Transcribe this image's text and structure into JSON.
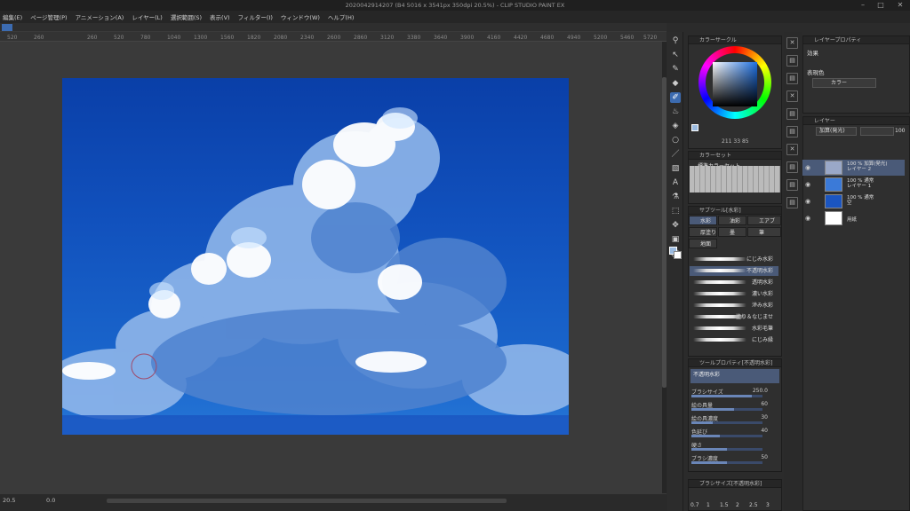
{
  "window": {
    "title": "2020042914207 (B4 5016 x 3541px 350dpi 20.5%) - CLIP STUDIO PAINT EX",
    "min": "–",
    "max": "□",
    "close": "✕"
  },
  "menu": [
    "編集(E)",
    "ページ管理(P)",
    "アニメーション(A)",
    "レイヤー(L)",
    "選択範囲(S)",
    "表示(V)",
    "フィルター(I)",
    "ウィンドウ(W)",
    "ヘルプ(H)"
  ],
  "ruler_ticks": [
    "520",
    "260",
    "260",
    "520",
    "780",
    "1040",
    "1300",
    "1560",
    "1820",
    "2080",
    "2340",
    "2600",
    "2860",
    "3120",
    "3380",
    "3640",
    "3900",
    "4160",
    "4420",
    "4680",
    "4940",
    "5200",
    "5460",
    "5720"
  ],
  "status": {
    "zoom": "20.5",
    "angle": "0.0"
  },
  "color_wheel": {
    "title": "カラーサークル",
    "h": "211",
    "s": "33",
    "v": "85"
  },
  "color_set": {
    "title": "カラーセット",
    "set_name": "標準カラーセット"
  },
  "sub_tool": {
    "title": "サブツール[水彩]",
    "tabs": [
      "水彩",
      "油彩",
      "エアブ",
      "厚塗り",
      "墨",
      "筆",
      "地面"
    ],
    "brushes": [
      "にじみ水彩",
      "不透明水彩",
      "透明水彩",
      "濃い水彩",
      "滲み水彩",
      "塗り＆なじませ",
      "水彩毛筆",
      "にじみ縁"
    ],
    "selected": 1
  },
  "tool_property": {
    "title": "ツールプロパティ[不透明水彩]",
    "tool_name": "不透明水彩",
    "props": [
      {
        "label": "ブラシサイズ",
        "value": "250.0",
        "fill": 0.85
      },
      {
        "label": "絵の具量",
        "value": "60",
        "fill": 0.6
      },
      {
        "label": "絵の具濃度",
        "value": "30",
        "fill": 0.3
      },
      {
        "label": "色延び",
        "value": "40",
        "fill": 0.4
      },
      {
        "label": "硬さ",
        "value": "",
        "fill": 0.5
      },
      {
        "label": "ブラシ濃度",
        "value": "50",
        "fill": 0.5
      }
    ]
  },
  "brush_size": {
    "title": "ブラシサイズ[不透明水彩]",
    "sizes": [
      "0.7",
      "1",
      "1.5",
      "2",
      "2.5",
      "3"
    ]
  },
  "layer_property": {
    "title": "レイヤープロパティ",
    "effect": "効果",
    "expression_label": "表現色",
    "expression_value": "カラー"
  },
  "layer_panel": {
    "title": "レイヤー",
    "blend": "加算(発光)",
    "opacity": "100",
    "layers": [
      {
        "line1": "100 % 加算(発光)",
        "line2": "レイヤー 2",
        "color": "#9aa8c8"
      },
      {
        "line1": "100 % 通常",
        "line2": "レイヤー 1",
        "color": "#3b7ad8"
      },
      {
        "line1": "100 % 通常",
        "line2": "空",
        "color": "#1b55c0"
      },
      {
        "line1": "",
        "line2": "用紙",
        "color": "#ffffff"
      }
    ]
  }
}
